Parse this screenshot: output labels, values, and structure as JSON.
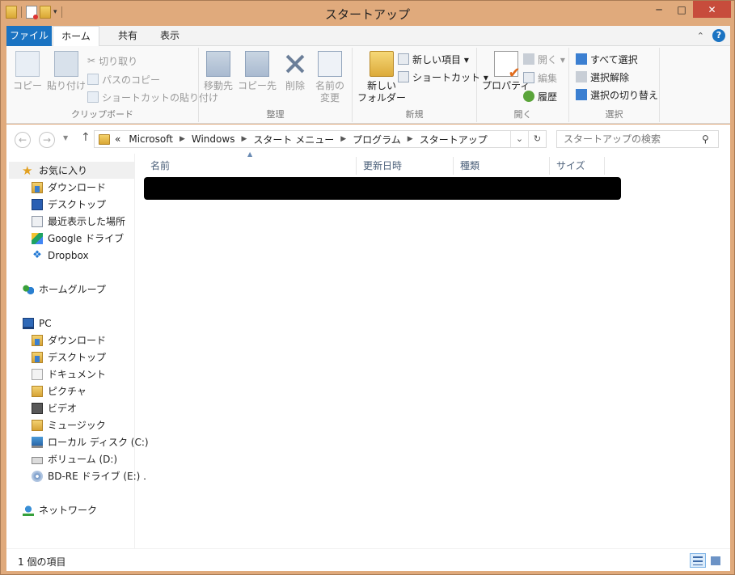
{
  "window": {
    "title": "スタートアップ",
    "minimize_glyph": "─",
    "maximize_glyph": "□",
    "close_glyph": "✕"
  },
  "ribbon_tabs": [
    "ファイル",
    "ホーム",
    "共有",
    "表示"
  ],
  "ribbon": {
    "clipboard": {
      "label": "クリップボード",
      "copy": "コピー",
      "paste": "貼り付け",
      "cut": "切り取り",
      "copy_path": "パスのコピー",
      "paste_shortcut": "ショートカットの貼り付け"
    },
    "organize": {
      "label": "整理",
      "move_to": "移動先",
      "copy_to": "コピー先",
      "delete": "削除",
      "rename_line1": "名前の",
      "rename_line2": "変更"
    },
    "new": {
      "label": "新規",
      "new_folder_line1": "新しい",
      "new_folder_line2": "フォルダー",
      "new_item": "新しい項目 ▾",
      "shortcut": "ショートカット ▾"
    },
    "open": {
      "label": "開く",
      "properties": "プロパティ",
      "open": "開く ▾",
      "edit": "編集",
      "history": "履歴"
    },
    "select": {
      "label": "選択",
      "select_all": "すべて選択",
      "select_none": "選択解除",
      "invert": "選択の切り替え"
    }
  },
  "address": {
    "prefix": "«",
    "breadcrumbs": [
      "Microsoft",
      "Windows",
      "スタート メニュー",
      "プログラム",
      "スタートアップ"
    ],
    "dropdown_glyph": "⌄",
    "refresh_glyph": "↻"
  },
  "search": {
    "placeholder": "スタートアップの検索"
  },
  "nav": {
    "back": "←",
    "forward": "→",
    "up": "↑"
  },
  "navpane": {
    "favorites": "お気に入り",
    "fav_items": [
      "ダウンロード",
      "デスクトップ",
      "最近表示した場所",
      "Google ドライブ",
      "Dropbox"
    ],
    "homegroup": "ホームグループ",
    "pc": "PC",
    "pc_items": [
      "ダウンロード",
      "デスクトップ",
      "ドキュメント",
      "ピクチャ",
      "ビデオ",
      "ミュージック",
      "ローカル ディスク (C:)",
      "ボリューム (D:)",
      "BD-RE ドライブ (E:) ."
    ],
    "network": "ネットワーク"
  },
  "columns": [
    "名前",
    "更新日時",
    "種類",
    "サイズ"
  ],
  "status": {
    "item_count": "1 個の項目"
  }
}
